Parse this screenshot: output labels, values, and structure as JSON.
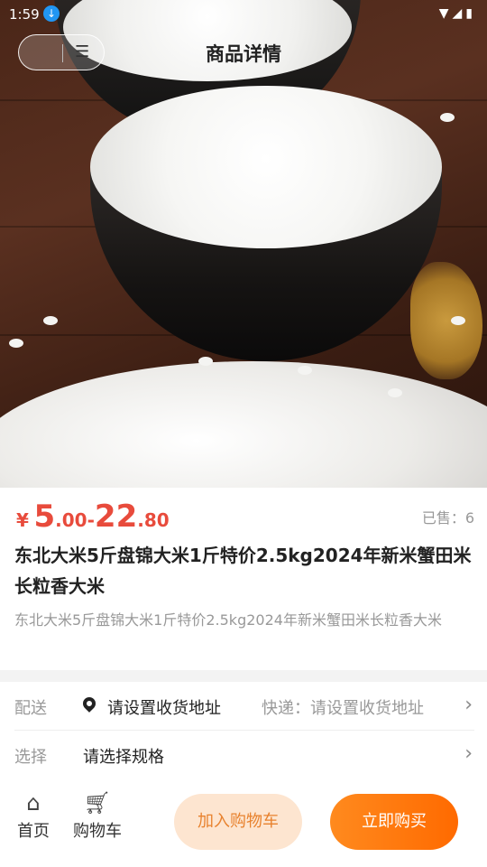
{
  "status_bar": {
    "time": "1:59"
  },
  "header": {
    "title": "商品详情",
    "menu_icon": "hamburger-icon"
  },
  "product": {
    "price": {
      "currency": "¥",
      "min_int": "5",
      "min_dec": ".00",
      "dash": "-",
      "max_int": "22",
      "max_dec": ".80"
    },
    "sold": "已售：6",
    "title": "东北大米5斤盘锦大米1斤特价2.5kg2024年新米蟹田米长粒香大米",
    "subtitle": "东北大米5斤盘锦大米1斤特价2.5kg2024年新米蟹田米长粒香大米"
  },
  "delivery": {
    "label": "配送",
    "address": "请设置收货地址",
    "express": "快递：请设置收货地址"
  },
  "spec": {
    "label": "选择",
    "value": "请选择规格"
  },
  "bottom_bar": {
    "home": "首页",
    "cart": "购物车",
    "add_to_cart": "加入购物车",
    "buy_now": "立即购买"
  },
  "colors": {
    "price": "#e84b3c",
    "accent": "#ff7a14",
    "cart_bg": "#fde5d0"
  }
}
